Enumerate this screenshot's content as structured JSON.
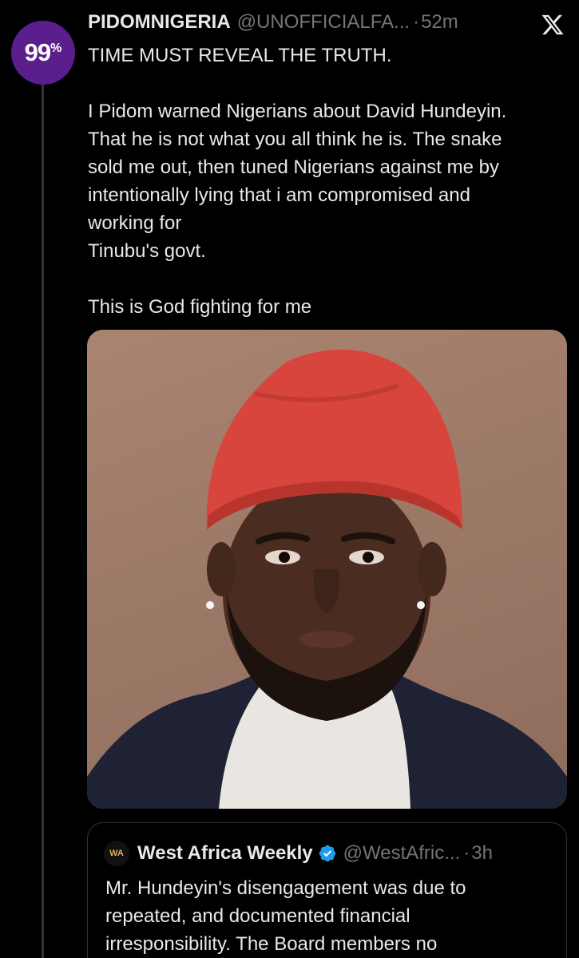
{
  "tweet": {
    "avatar_text": "99",
    "avatar_pct": "%",
    "display_name": "PIDOMNIGERIA",
    "handle": "@UNOFFICIALFA...",
    "separator": "·",
    "time": "52m",
    "lines": [
      "TIME MUST REVEAL THE TRUTH.",
      "",
      "I Pidom warned Nigerians about David Hundeyin.",
      "That he is not what you all think he is. The snake",
      "sold me out, then tuned Nigerians against me by",
      "intentionally lying that i am compromised and",
      "working for",
      "Tinubu's govt.",
      "",
      "This is God fighting for me"
    ],
    "media_icon": "portrait-photo"
  },
  "quote": {
    "avatar_text": "WA",
    "display_name": "West Africa Weekly",
    "verified_icon": "verified-badge-icon",
    "handle": "@WestAfric...",
    "separator": "·",
    "time": "3h",
    "lines": [
      "Mr. Hundeyin's disengagement was due to",
      "repeated, and documented financial",
      "irresponsibility. The Board members no"
    ]
  },
  "colors": {
    "background": "#000000",
    "text": "#e7e9ea",
    "muted": "#71767b",
    "avatar": "#5a1f8c",
    "verified": "#1d9bf0",
    "cap": "#d8453c"
  }
}
